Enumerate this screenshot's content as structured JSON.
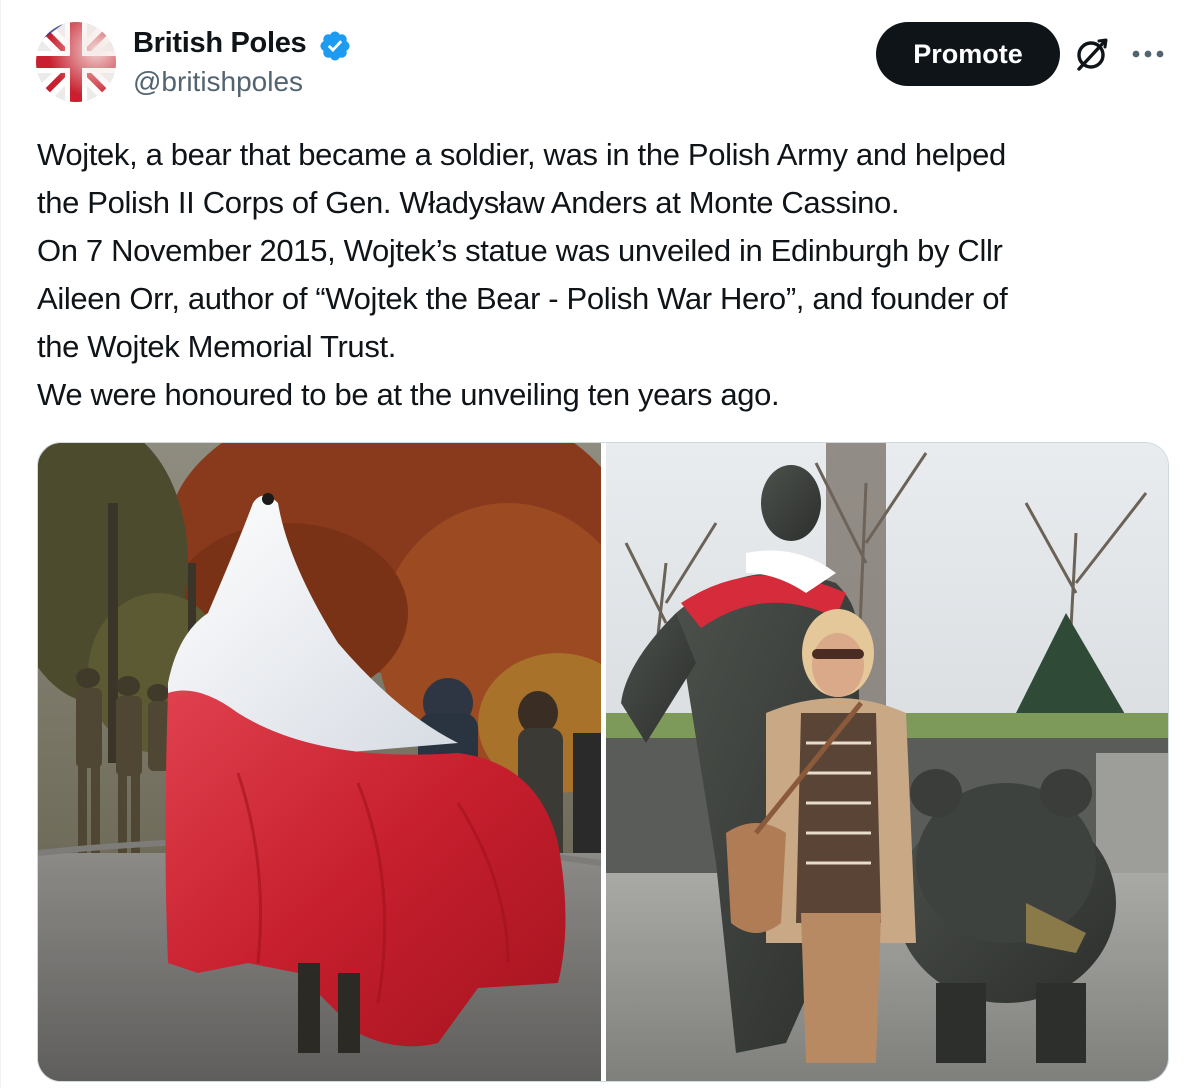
{
  "tweet": {
    "author": {
      "display_name": "British Poles",
      "handle": "@britishpoles",
      "verified": true,
      "verified_color": "#1d9bf0",
      "avatar_icon": "union-jack-avatar"
    },
    "actions": {
      "promote_label": "Promote",
      "grok_icon": "grok-icon",
      "more_icon": "more-horizontal-icon"
    },
    "text_lines": [
      "Wojtek, a bear that became a soldier, was in the Polish Army and helped",
      "the Polish II Corps of Gen. Władysław Anders at Monte Cassino.",
      "On 7 November 2015, Wojtek’s statue was unveiled in Edinburgh by Cllr",
      "Aileen Orr, author of “Wojtek the Bear - Polish War Hero”, and founder of",
      "the Wojtek Memorial Trust.",
      "We were honoured to be at the unveiling ten years ago."
    ],
    "media": [
      {
        "kind": "photo",
        "icon": "statue-veiled-in-polish-flag-photo"
      },
      {
        "kind": "photo",
        "icon": "woman-with-wojtek-statue-photo"
      }
    ],
    "colors": {
      "text": "#0f1419",
      "secondary": "#536471",
      "button": "#0f1419",
      "polish_red": "#d52b3a",
      "polish_white": "#ffffff"
    }
  }
}
